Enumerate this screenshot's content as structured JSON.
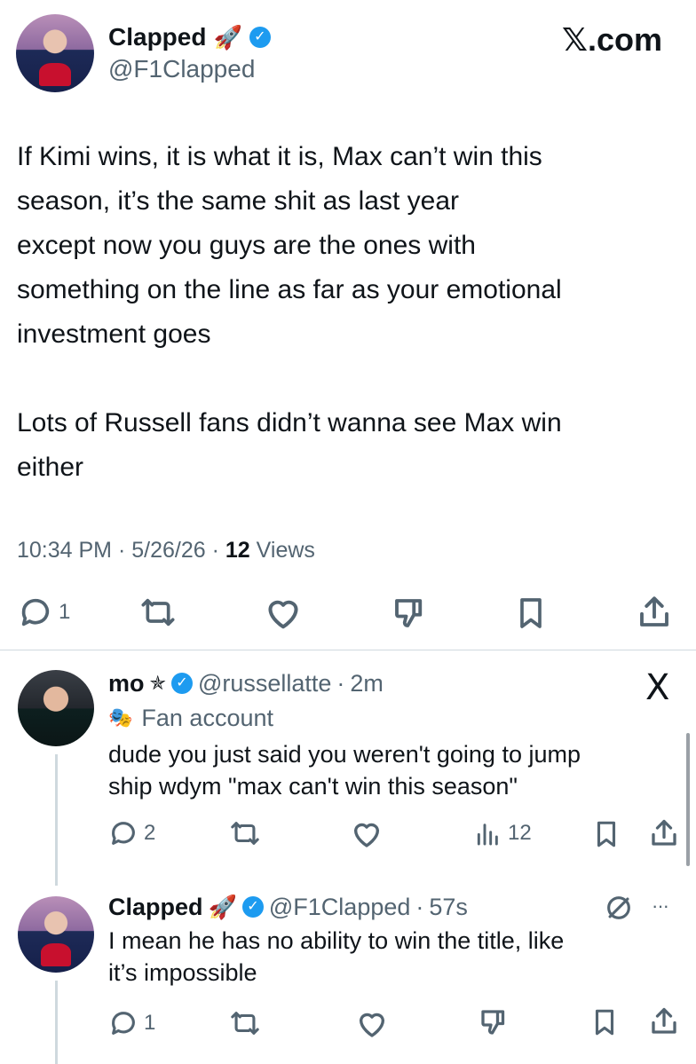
{
  "main_tweet": {
    "author_name": "Clapped",
    "author_emoji": "🚀",
    "handle": "@F1Clapped",
    "brand": "𝕏.com",
    "text_lines": [
      "If Kimi wins, it is what it is, Max can’t win this",
      "season, it’s the same shit as last year",
      "except now you guys are the ones with",
      "something on the line as far as your emotional",
      "investment goes",
      "",
      "Lots of Russell fans didn’t wanna see Max win",
      "either"
    ],
    "time": "10:34 PM",
    "date": "5/26/26",
    "separator": "·",
    "views_count": "12",
    "views_label": "Views",
    "reply_count": "1"
  },
  "reply_1": {
    "author_name": "mo",
    "author_symbol": "✯",
    "handle": "@russellatte",
    "time": "2m",
    "separator": "·",
    "label_icon": "🎭",
    "label": "Fan account",
    "text_lines": [
      "dude you just said you weren't going to jump",
      "ship wdym \"max can't win this season\""
    ],
    "reply_count": "2",
    "views_count": "12",
    "close_glyph": "X"
  },
  "reply_2": {
    "author_name": "Clapped",
    "author_emoji": "🚀",
    "handle": "@F1Clapped",
    "time": "57s",
    "separator": "·",
    "more_glyph": "···",
    "text_lines": [
      "I mean he has no ability to win the title, like",
      "it’s impossible"
    ],
    "reply_count": "1"
  },
  "icons": [
    "reply-icon",
    "retweet-icon",
    "like-icon",
    "dislike-icon",
    "bookmark-icon",
    "share-icon",
    "analytics-icon",
    "verified-icon",
    "no-entry-icon"
  ],
  "colors": {
    "verified": "#1d9bf0",
    "secondary_text": "#536471",
    "divider": "#cfd9de"
  }
}
